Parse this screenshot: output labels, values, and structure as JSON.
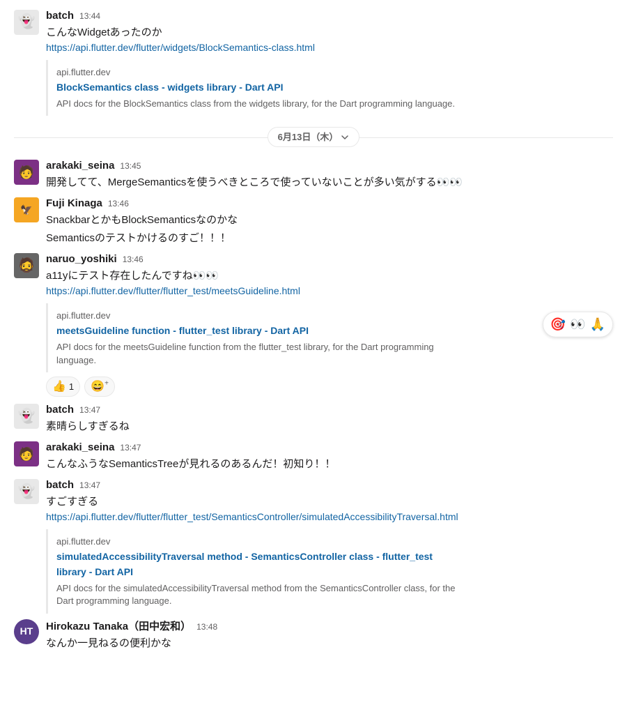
{
  "date_divider": {
    "label": "6月13日（木）",
    "chevron": "▾"
  },
  "messages": [
    {
      "id": "msg1",
      "sender": "batch",
      "timestamp": "13:44",
      "avatar_type": "ghost",
      "text": "こんなWidgetあったのか",
      "link": "https://api.flutter.dev/flutter/widgets/BlockSemantics-class.html",
      "preview": {
        "domain": "api.flutter.dev",
        "title": "BlockSemantics class - widgets library - Dart API",
        "title_link": "https://api.flutter.dev/flutter/widgets/BlockSemantics-class.html",
        "desc": "API docs for the BlockSemantics class from the widgets library, for the Dart programming language."
      }
    },
    {
      "id": "msg2",
      "sender": "arakaki_seina",
      "timestamp": "13:45",
      "avatar_type": "purple",
      "text": "開発してて、MergeSemanticsを使うべきところで使っていないことが多い気がする👀👀"
    },
    {
      "id": "msg3",
      "sender": "Fuji Kinaga",
      "timestamp": "13:46",
      "avatar_type": "yellow",
      "text": "SnackbarとかもBlockSemanticsなのかな",
      "text2": "Semanticsのテストかけるのすご！！！"
    },
    {
      "id": "msg4",
      "sender": "naruo_yoshiki",
      "timestamp": "13:46",
      "avatar_type": "naruo",
      "text": "a11yにテスト存在したんですね👀👀",
      "link": "https://api.flutter.dev/flutter/flutter_test/meetsGuideline.html",
      "preview": {
        "domain": "api.flutter.dev",
        "title": "meetsGuideline function - flutter_test library - Dart API",
        "title_link": "https://api.flutter.dev/flutter/flutter_test/meetsGuideline.html",
        "desc": "API docs for the meetsGuideline function from the flutter_test library, for the Dart programming language."
      },
      "reactions": [
        {
          "emoji": "👍",
          "count": "1"
        }
      ],
      "reaction_add": true,
      "emoji_popup": [
        "🎯",
        "👀",
        "🙏"
      ]
    },
    {
      "id": "msg5",
      "sender": "batch",
      "timestamp": "13:47",
      "avatar_type": "ghost",
      "text": "素晴らしすぎるね"
    },
    {
      "id": "msg6",
      "sender": "arakaki_seina",
      "timestamp": "13:47",
      "avatar_type": "purple",
      "text": "こんなふうなSemanticsTreeが見れるのあるんだ！初知り！！"
    },
    {
      "id": "msg7",
      "sender": "batch",
      "timestamp": "13:47",
      "avatar_type": "ghost",
      "text": "すごすぎる",
      "link": "https://api.flutter.dev/flutter/flutter_test/SemanticsController/simulatedAccessibilityTraversal.html",
      "preview": {
        "domain": "api.flutter.dev",
        "title": "simulatedAccessibilityTraversal method - SemanticsController class - flutter_test library - Dart API",
        "title_link": "https://api.flutter.dev/flutter/flutter_test/SemanticsController/simulatedAccessibilityTraversal.html",
        "desc": "API docs for the simulatedAccessibilityTraversal method from the SemanticsController class, for the Dart programming language."
      }
    },
    {
      "id": "msg8",
      "sender": "Hirokazu Tanaka（田中宏和）",
      "timestamp": "13:48",
      "avatar_type": "hirokazu",
      "text": "なんか一見ねるの便利かな"
    }
  ],
  "labels": {
    "reaction_add_label": "😄+"
  }
}
